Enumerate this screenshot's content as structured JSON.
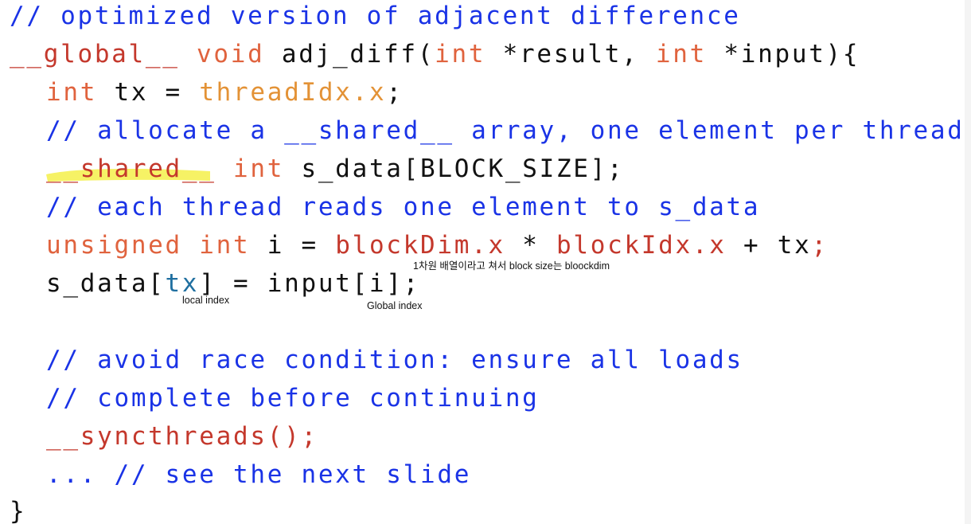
{
  "code": {
    "l1": "// optimized version of adjacent difference",
    "l2": {
      "global": "__global__",
      "void": "void",
      "sig_a": "adj_diff(",
      "int1": "int",
      "sig_b": "*result,",
      "int2": "int",
      "sig_c": "*input){"
    },
    "l3": {
      "int": "int",
      "mid": "tx =",
      "thread_idx": "threadIdx.x",
      "semi": ";"
    },
    "l4": "// allocate a __shared__ array, one element per thread",
    "l5": {
      "shared": "__shared__",
      "int": "int",
      "rest": "s_data[BLOCK_SIZE];"
    },
    "l6": "// each thread reads one element to s_data",
    "l7": {
      "unsigned_int": "unsigned int",
      "mid": "i =",
      "block_dim": "blockDim.x",
      "star": "*",
      "block_idx": "blockIdx.x",
      "plus": "+ tx",
      "semi": ";"
    },
    "l8": {
      "s_data": "s_data[",
      "tx": "tx",
      "rest": "] = input[i];"
    },
    "l9": "// avoid race condition: ensure all loads",
    "l10": "// complete before continuing",
    "l11": "__syncthreads();",
    "l12": "... // see the next slide",
    "l13": "}"
  },
  "annotations": {
    "block_note": "1차원 배열이라고 쳐서 block size는 bloockdim",
    "local_index": "local index",
    "global_index": "Global index"
  },
  "colors": {
    "comment": "#1a33e6",
    "keyword": "#e0633e",
    "builtin": "#e39236",
    "function": "#c4382c",
    "highlight": "#f5f04a"
  }
}
